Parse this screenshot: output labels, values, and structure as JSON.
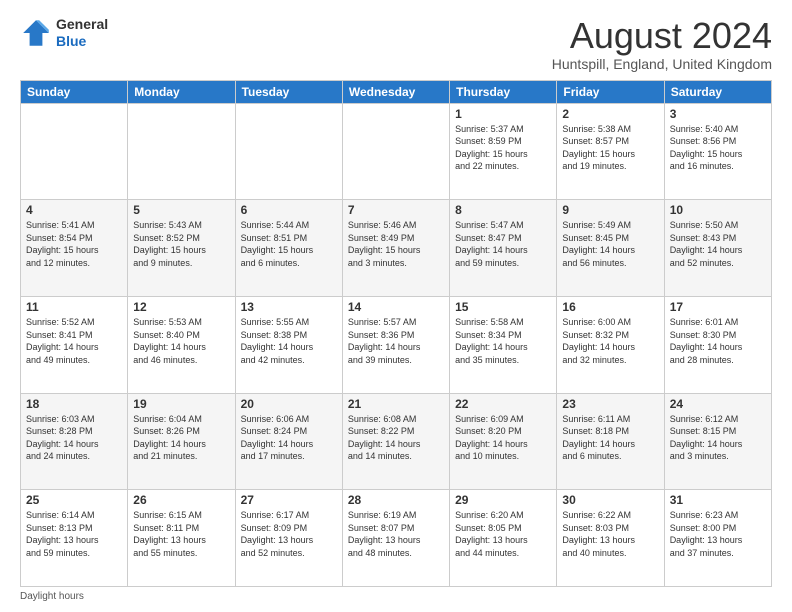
{
  "header": {
    "logo_line1": "General",
    "logo_line2": "Blue",
    "month_year": "August 2024",
    "location": "Huntspill, England, United Kingdom"
  },
  "days_of_week": [
    "Sunday",
    "Monday",
    "Tuesday",
    "Wednesday",
    "Thursday",
    "Friday",
    "Saturday"
  ],
  "weeks": [
    [
      {
        "day": "",
        "info": ""
      },
      {
        "day": "",
        "info": ""
      },
      {
        "day": "",
        "info": ""
      },
      {
        "day": "",
        "info": ""
      },
      {
        "day": "1",
        "info": "Sunrise: 5:37 AM\nSunset: 8:59 PM\nDaylight: 15 hours\nand 22 minutes."
      },
      {
        "day": "2",
        "info": "Sunrise: 5:38 AM\nSunset: 8:57 PM\nDaylight: 15 hours\nand 19 minutes."
      },
      {
        "day": "3",
        "info": "Sunrise: 5:40 AM\nSunset: 8:56 PM\nDaylight: 15 hours\nand 16 minutes."
      }
    ],
    [
      {
        "day": "4",
        "info": "Sunrise: 5:41 AM\nSunset: 8:54 PM\nDaylight: 15 hours\nand 12 minutes."
      },
      {
        "day": "5",
        "info": "Sunrise: 5:43 AM\nSunset: 8:52 PM\nDaylight: 15 hours\nand 9 minutes."
      },
      {
        "day": "6",
        "info": "Sunrise: 5:44 AM\nSunset: 8:51 PM\nDaylight: 15 hours\nand 6 minutes."
      },
      {
        "day": "7",
        "info": "Sunrise: 5:46 AM\nSunset: 8:49 PM\nDaylight: 15 hours\nand 3 minutes."
      },
      {
        "day": "8",
        "info": "Sunrise: 5:47 AM\nSunset: 8:47 PM\nDaylight: 14 hours\nand 59 minutes."
      },
      {
        "day": "9",
        "info": "Sunrise: 5:49 AM\nSunset: 8:45 PM\nDaylight: 14 hours\nand 56 minutes."
      },
      {
        "day": "10",
        "info": "Sunrise: 5:50 AM\nSunset: 8:43 PM\nDaylight: 14 hours\nand 52 minutes."
      }
    ],
    [
      {
        "day": "11",
        "info": "Sunrise: 5:52 AM\nSunset: 8:41 PM\nDaylight: 14 hours\nand 49 minutes."
      },
      {
        "day": "12",
        "info": "Sunrise: 5:53 AM\nSunset: 8:40 PM\nDaylight: 14 hours\nand 46 minutes."
      },
      {
        "day": "13",
        "info": "Sunrise: 5:55 AM\nSunset: 8:38 PM\nDaylight: 14 hours\nand 42 minutes."
      },
      {
        "day": "14",
        "info": "Sunrise: 5:57 AM\nSunset: 8:36 PM\nDaylight: 14 hours\nand 39 minutes."
      },
      {
        "day": "15",
        "info": "Sunrise: 5:58 AM\nSunset: 8:34 PM\nDaylight: 14 hours\nand 35 minutes."
      },
      {
        "day": "16",
        "info": "Sunrise: 6:00 AM\nSunset: 8:32 PM\nDaylight: 14 hours\nand 32 minutes."
      },
      {
        "day": "17",
        "info": "Sunrise: 6:01 AM\nSunset: 8:30 PM\nDaylight: 14 hours\nand 28 minutes."
      }
    ],
    [
      {
        "day": "18",
        "info": "Sunrise: 6:03 AM\nSunset: 8:28 PM\nDaylight: 14 hours\nand 24 minutes."
      },
      {
        "day": "19",
        "info": "Sunrise: 6:04 AM\nSunset: 8:26 PM\nDaylight: 14 hours\nand 21 minutes."
      },
      {
        "day": "20",
        "info": "Sunrise: 6:06 AM\nSunset: 8:24 PM\nDaylight: 14 hours\nand 17 minutes."
      },
      {
        "day": "21",
        "info": "Sunrise: 6:08 AM\nSunset: 8:22 PM\nDaylight: 14 hours\nand 14 minutes."
      },
      {
        "day": "22",
        "info": "Sunrise: 6:09 AM\nSunset: 8:20 PM\nDaylight: 14 hours\nand 10 minutes."
      },
      {
        "day": "23",
        "info": "Sunrise: 6:11 AM\nSunset: 8:18 PM\nDaylight: 14 hours\nand 6 minutes."
      },
      {
        "day": "24",
        "info": "Sunrise: 6:12 AM\nSunset: 8:15 PM\nDaylight: 14 hours\nand 3 minutes."
      }
    ],
    [
      {
        "day": "25",
        "info": "Sunrise: 6:14 AM\nSunset: 8:13 PM\nDaylight: 13 hours\nand 59 minutes."
      },
      {
        "day": "26",
        "info": "Sunrise: 6:15 AM\nSunset: 8:11 PM\nDaylight: 13 hours\nand 55 minutes."
      },
      {
        "day": "27",
        "info": "Sunrise: 6:17 AM\nSunset: 8:09 PM\nDaylight: 13 hours\nand 52 minutes."
      },
      {
        "day": "28",
        "info": "Sunrise: 6:19 AM\nSunset: 8:07 PM\nDaylight: 13 hours\nand 48 minutes."
      },
      {
        "day": "29",
        "info": "Sunrise: 6:20 AM\nSunset: 8:05 PM\nDaylight: 13 hours\nand 44 minutes."
      },
      {
        "day": "30",
        "info": "Sunrise: 6:22 AM\nSunset: 8:03 PM\nDaylight: 13 hours\nand 40 minutes."
      },
      {
        "day": "31",
        "info": "Sunrise: 6:23 AM\nSunset: 8:00 PM\nDaylight: 13 hours\nand 37 minutes."
      }
    ]
  ],
  "footer": {
    "text": "Daylight hours"
  }
}
